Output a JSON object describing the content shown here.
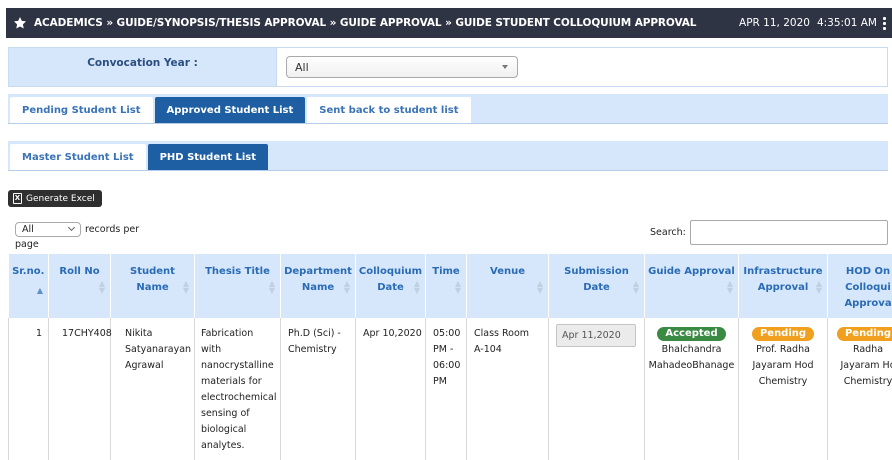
{
  "header": {
    "breadcrumb": "ACADEMICS » GUIDE/SYNOPSIS/THESIS APPROVAL » GUIDE APPROVAL » GUIDE STUDENT COLLOQUIUM APPROVAL",
    "date": "APR 11, 2020",
    "time": "4:35:01 AM",
    "icon": "star-icon"
  },
  "filter": {
    "label": "Convocation Year :",
    "selected": "All"
  },
  "tabs_status": [
    {
      "label": "Pending Student List",
      "active": false
    },
    {
      "label": "Approved Student List",
      "active": true
    },
    {
      "label": "Sent back to student list",
      "active": false
    }
  ],
  "tabs_program": [
    {
      "label": "Master Student List",
      "active": false
    },
    {
      "label": "PHD Student List",
      "active": true
    }
  ],
  "toolbar": {
    "excel_label": "Generate Excel"
  },
  "table_controls": {
    "length_selected": "All",
    "length_text_1": "records per",
    "length_text_2": "page",
    "search_label": "Search:"
  },
  "table": {
    "headers": [
      [
        "Sr.no."
      ],
      [
        "Roll No"
      ],
      [
        "Student",
        "Name"
      ],
      [
        "Thesis Title"
      ],
      [
        "Department",
        "Name"
      ],
      [
        "Colloquium",
        "Date"
      ],
      [
        "Time"
      ],
      [
        "Venue"
      ],
      [
        "Submission",
        "Date"
      ],
      [
        "Guide Approval"
      ],
      [
        "Infrastructure",
        "Approval"
      ],
      [
        "HOD On",
        "Colloqui",
        "Approva"
      ]
    ],
    "rows": [
      {
        "srno": "1",
        "roll": "17CHY408",
        "name": [
          "Nikita",
          "Satyanarayan",
          "Agrawal"
        ],
        "thesis": [
          "Fabrication",
          "with",
          "nanocrystalline",
          "materials for",
          "electrochemical",
          "sensing of",
          "biological",
          "analytes."
        ],
        "department": [
          "Ph.D (Sci) -",
          "Chemistry"
        ],
        "colloquium_date": "Apr 10,2020",
        "time": [
          "05:00",
          "PM -",
          "06:00",
          "PM"
        ],
        "venue": [
          "Class Room",
          "A-104"
        ],
        "submission_date": "Apr 11,2020",
        "guide": {
          "status": "Accepted",
          "by": [
            "Bhalchandra",
            "MahadeoBhanage"
          ]
        },
        "infra": {
          "status": "Pending",
          "by": [
            "Prof. Radha",
            "Jayaram Hod",
            "Chemistry"
          ]
        },
        "hod": {
          "status": "Pending",
          "by": [
            "Radha",
            "Jayaram Ho",
            "Chemistry"
          ]
        }
      }
    ]
  },
  "colors": {
    "topbar": "#2e3443",
    "tab_active": "#1e5fa3",
    "light_blue": "#d6e7fb",
    "accepted": "#3a8a43",
    "pending": "#f0a01e"
  }
}
